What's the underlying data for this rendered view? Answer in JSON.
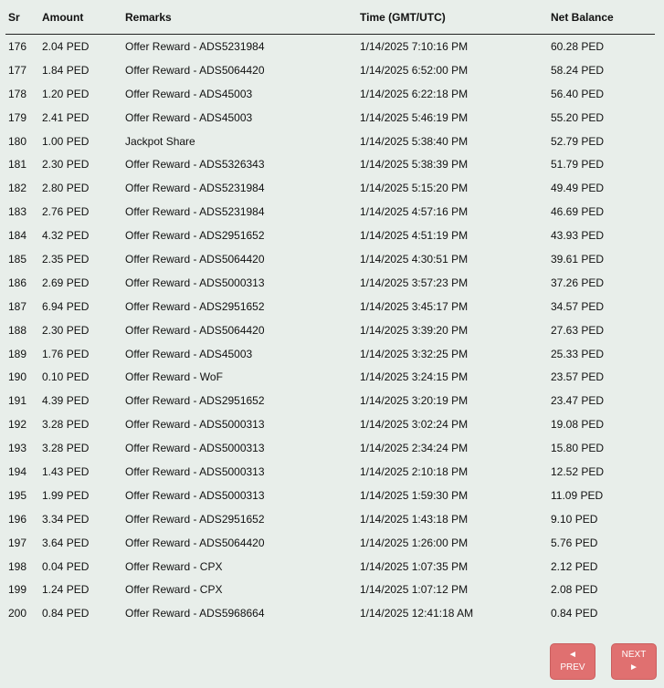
{
  "table": {
    "headers": [
      "Sr",
      "Amount",
      "Remarks",
      "Time (GMT/UTC)",
      "Net Balance"
    ],
    "rows": [
      [
        "176",
        "2.04 PED",
        "Offer Reward - ADS5231984",
        "1/14/2025 7:10:16 PM",
        "60.28 PED"
      ],
      [
        "177",
        "1.84 PED",
        "Offer Reward - ADS5064420",
        "1/14/2025 6:52:00 PM",
        "58.24 PED"
      ],
      [
        "178",
        "1.20 PED",
        "Offer Reward - ADS45003",
        "1/14/2025 6:22:18 PM",
        "56.40 PED"
      ],
      [
        "179",
        "2.41 PED",
        "Offer Reward - ADS45003",
        "1/14/2025 5:46:19 PM",
        "55.20 PED"
      ],
      [
        "180",
        "1.00 PED",
        "Jackpot Share",
        "1/14/2025 5:38:40 PM",
        "52.79 PED"
      ],
      [
        "181",
        "2.30 PED",
        "Offer Reward - ADS5326343",
        "1/14/2025 5:38:39 PM",
        "51.79 PED"
      ],
      [
        "182",
        "2.80 PED",
        "Offer Reward - ADS5231984",
        "1/14/2025 5:15:20 PM",
        "49.49 PED"
      ],
      [
        "183",
        "2.76 PED",
        "Offer Reward - ADS5231984",
        "1/14/2025 4:57:16 PM",
        "46.69 PED"
      ],
      [
        "184",
        "4.32 PED",
        "Offer Reward - ADS2951652",
        "1/14/2025 4:51:19 PM",
        "43.93 PED"
      ],
      [
        "185",
        "2.35 PED",
        "Offer Reward - ADS5064420",
        "1/14/2025 4:30:51 PM",
        "39.61 PED"
      ],
      [
        "186",
        "2.69 PED",
        "Offer Reward - ADS5000313",
        "1/14/2025 3:57:23 PM",
        "37.26 PED"
      ],
      [
        "187",
        "6.94 PED",
        "Offer Reward - ADS2951652",
        "1/14/2025 3:45:17 PM",
        "34.57 PED"
      ],
      [
        "188",
        "2.30 PED",
        "Offer Reward - ADS5064420",
        "1/14/2025 3:39:20 PM",
        "27.63 PED"
      ],
      [
        "189",
        "1.76 PED",
        "Offer Reward - ADS45003",
        "1/14/2025 3:32:25 PM",
        "25.33 PED"
      ],
      [
        "190",
        "0.10 PED",
        "Offer Reward - WoF",
        "1/14/2025 3:24:15 PM",
        "23.57 PED"
      ],
      [
        "191",
        "4.39 PED",
        "Offer Reward - ADS2951652",
        "1/14/2025 3:20:19 PM",
        "23.47 PED"
      ],
      [
        "192",
        "3.28 PED",
        "Offer Reward - ADS5000313",
        "1/14/2025 3:02:24 PM",
        "19.08 PED"
      ],
      [
        "193",
        "3.28 PED",
        "Offer Reward - ADS5000313",
        "1/14/2025 2:34:24 PM",
        "15.80 PED"
      ],
      [
        "194",
        "1.43 PED",
        "Offer Reward - ADS5000313",
        "1/14/2025 2:10:18 PM",
        "12.52 PED"
      ],
      [
        "195",
        "1.99 PED",
        "Offer Reward - ADS5000313",
        "1/14/2025 1:59:30 PM",
        "11.09 PED"
      ],
      [
        "196",
        "3.34 PED",
        "Offer Reward - ADS2951652",
        "1/14/2025 1:43:18 PM",
        "9.10 PED"
      ],
      [
        "197",
        "3.64 PED",
        "Offer Reward - ADS5064420",
        "1/14/2025 1:26:00 PM",
        "5.76 PED"
      ],
      [
        "198",
        "0.04 PED",
        "Offer Reward - CPX",
        "1/14/2025 1:07:35 PM",
        "2.12 PED"
      ],
      [
        "199",
        "1.24 PED",
        "Offer Reward - CPX",
        "1/14/2025 1:07:12 PM",
        "2.08 PED"
      ],
      [
        "200",
        "0.84 PED",
        "Offer Reward - ADS5968664",
        "1/14/2025 12:41:18 AM",
        "0.84 PED"
      ]
    ]
  },
  "pagination": {
    "prev_icon": "◄",
    "prev_label": "PREV",
    "next_label": "NEXT",
    "next_icon": "►"
  },
  "colors": {
    "background": "#e8eeea",
    "button": "#e07070"
  }
}
